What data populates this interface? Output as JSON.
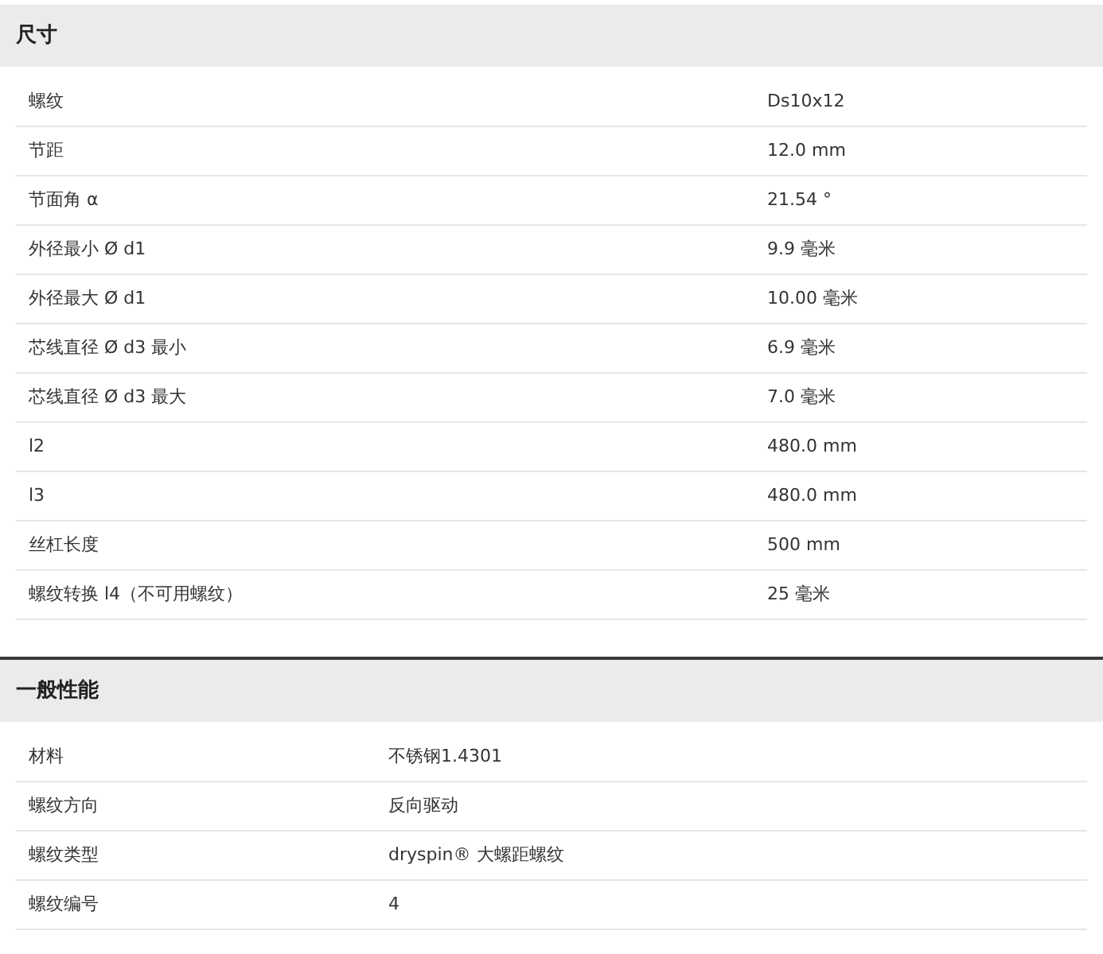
{
  "sections": [
    {
      "title": "尺寸",
      "kind": "wide",
      "rows": [
        {
          "label": "螺纹",
          "value": "Ds10x12"
        },
        {
          "label": "节距",
          "value": "12.0 mm"
        },
        {
          "label": "节面角 α",
          "value": "21.54 °"
        },
        {
          "label": "外径最小 Ø d1",
          "value": "9.9 毫米"
        },
        {
          "label": "外径最大 Ø d1",
          "value": "10.00 毫米"
        },
        {
          "label": "芯线直径 Ø d3 最小",
          "value": "6.9 毫米"
        },
        {
          "label": "芯线直径 Ø d3 最大",
          "value": "7.0 毫米"
        },
        {
          "label": "l2",
          "value": "480.0 mm"
        },
        {
          "label": "l3",
          "value": "480.0 mm"
        },
        {
          "label": "丝杠长度",
          "value": "500 mm"
        },
        {
          "label": "螺纹转换 l4（不可用螺纹）",
          "value": "25 毫米"
        }
      ]
    },
    {
      "title": "一般性能",
      "kind": "narrow",
      "rows": [
        {
          "label": "材料",
          "value": "不锈钢1.4301"
        },
        {
          "label": "螺纹方向",
          "value": "反向驱动"
        },
        {
          "label": "螺纹类型",
          "value": "dryspin® 大螺距螺纹"
        },
        {
          "label": "螺纹编号",
          "value": "4"
        }
      ]
    }
  ]
}
